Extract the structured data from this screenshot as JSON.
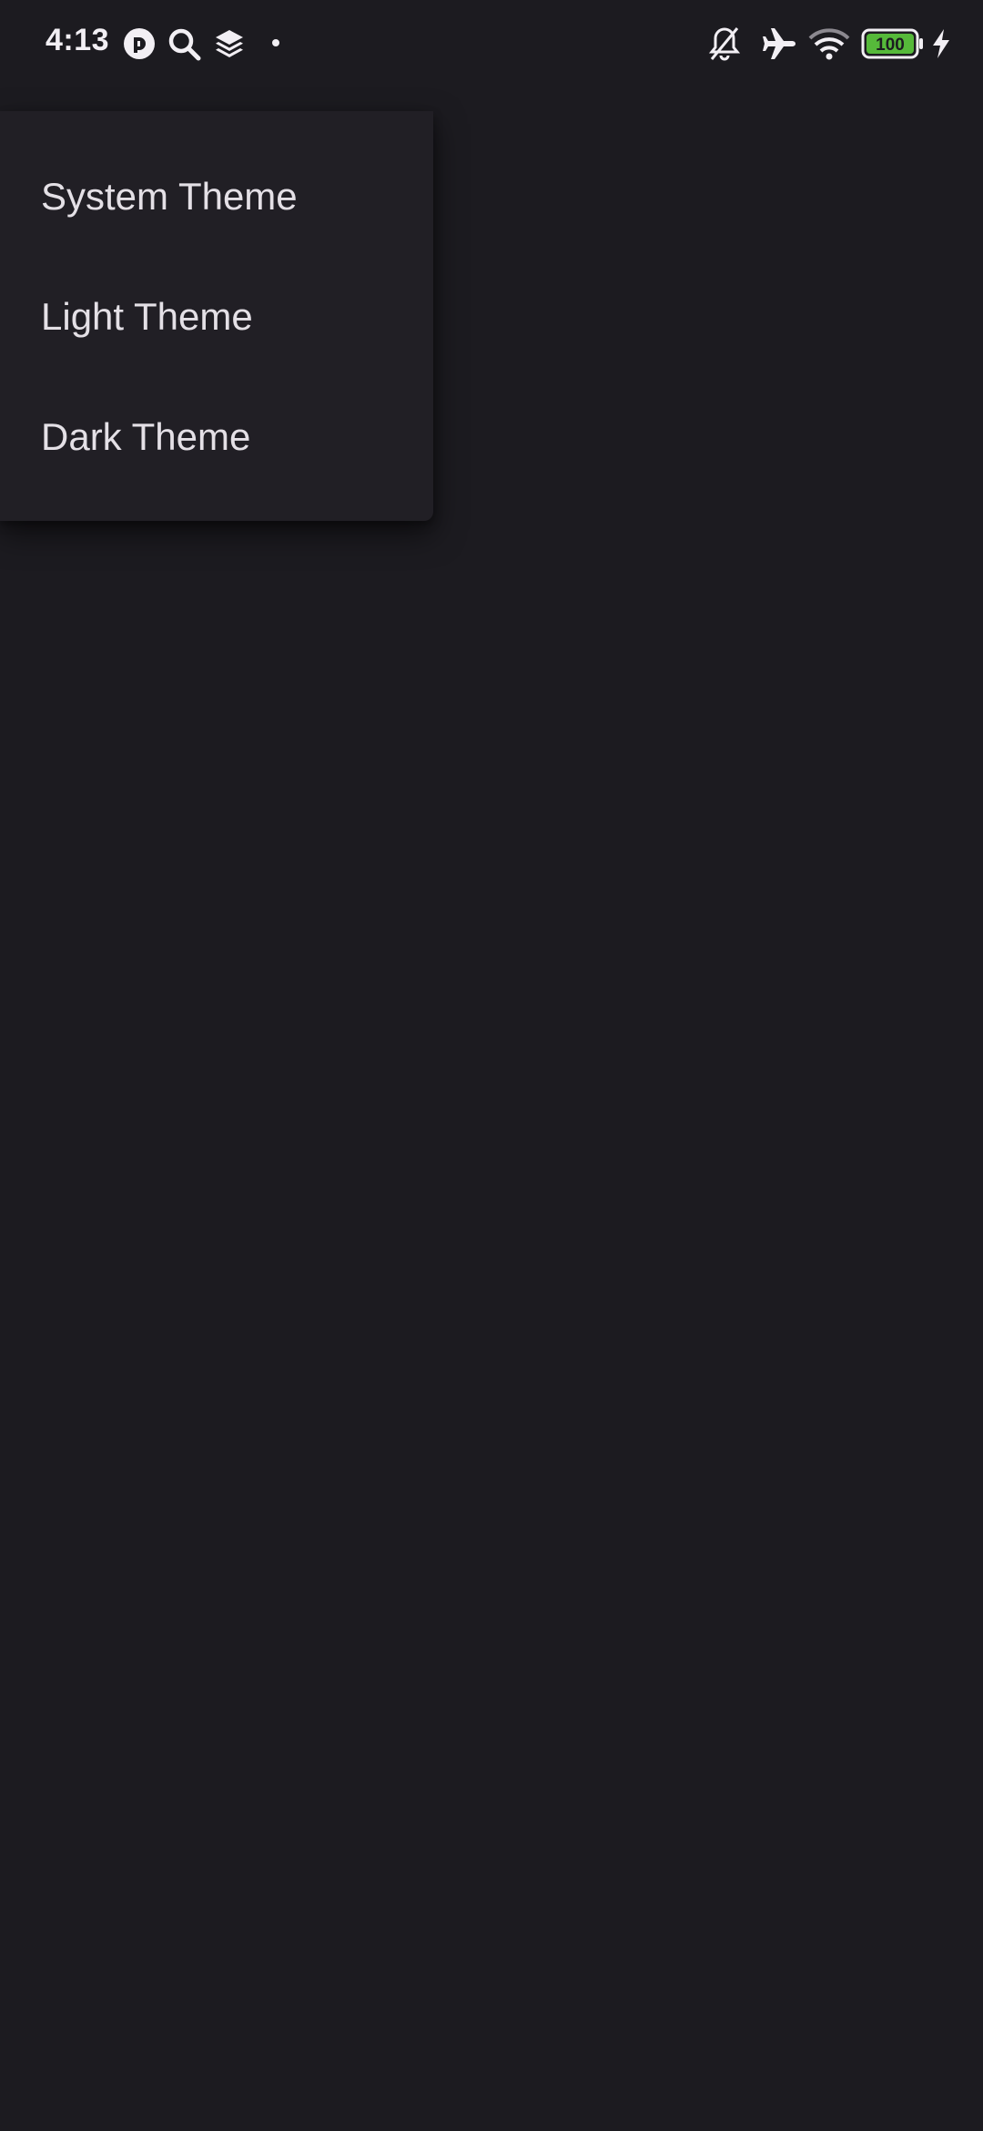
{
  "status_bar": {
    "time": "4:13",
    "battery_level": "100",
    "battery_color": "#56b93a",
    "left_icons": [
      "pocket-casts-icon",
      "search-icon",
      "layers-icon",
      "notification-dot-icon"
    ],
    "right_icons": [
      "bell-off-icon",
      "airplane-icon",
      "wifi-icon",
      "battery-icon",
      "charging-bolt-icon"
    ]
  },
  "theme_menu": {
    "items": [
      {
        "label": "System Theme"
      },
      {
        "label": "Light Theme"
      },
      {
        "label": "Dark Theme"
      }
    ]
  },
  "colors": {
    "background": "#1c1b20",
    "menu_surface": "#211f25",
    "text": "#e4e0e6"
  }
}
